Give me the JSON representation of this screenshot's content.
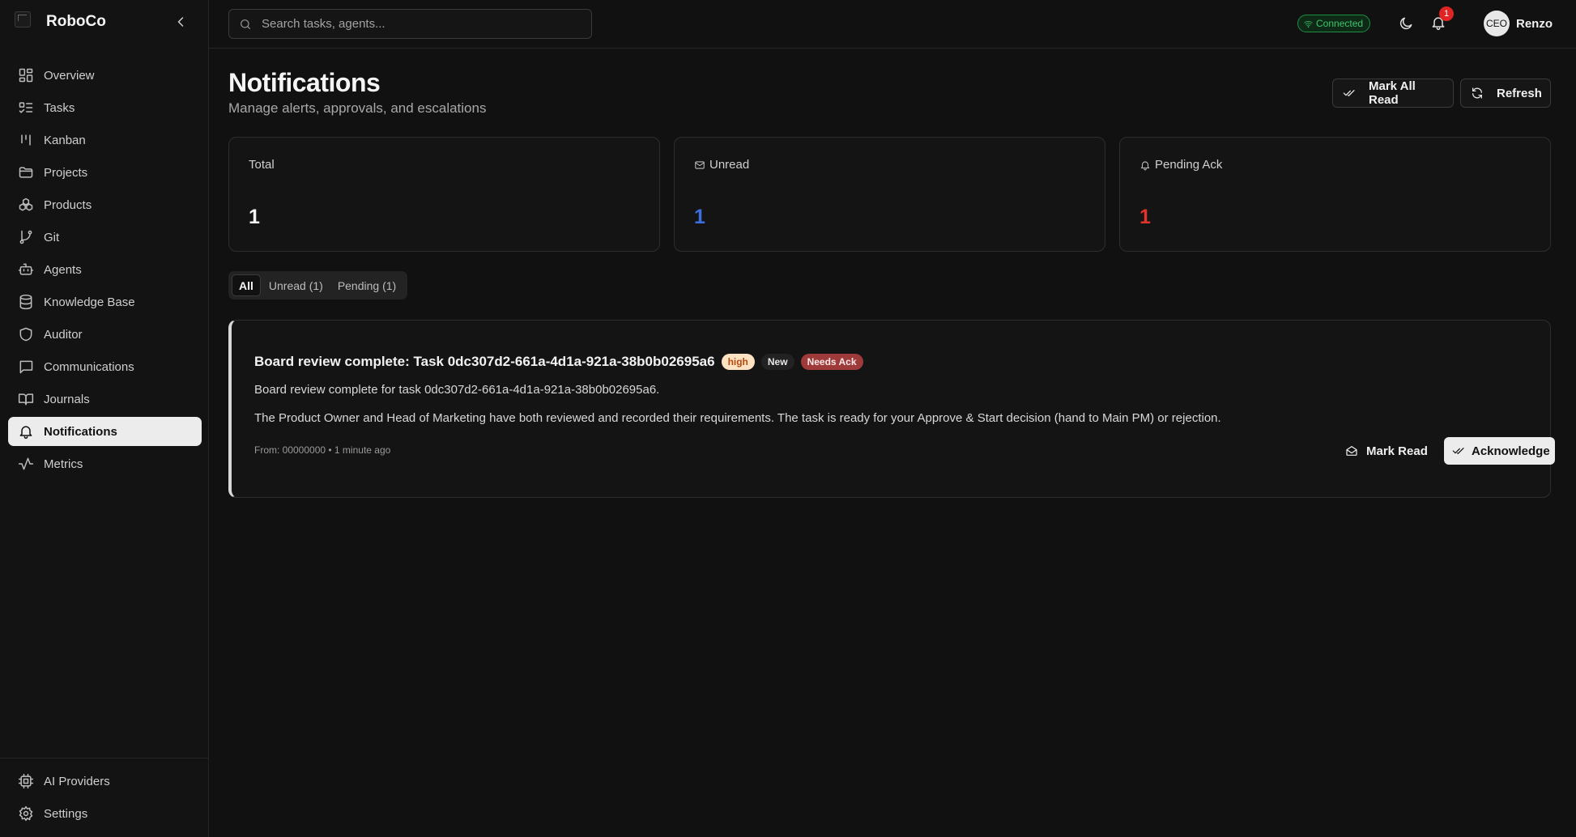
{
  "app": {
    "name": "RoboCo"
  },
  "sidebar": {
    "items": [
      {
        "label": "Overview",
        "icon": "layout-dashboard-icon"
      },
      {
        "label": "Tasks",
        "icon": "list-todo-icon"
      },
      {
        "label": "Kanban",
        "icon": "kanban-icon"
      },
      {
        "label": "Projects",
        "icon": "folder-icon"
      },
      {
        "label": "Products",
        "icon": "boxes-icon"
      },
      {
        "label": "Git",
        "icon": "git-branch-icon"
      },
      {
        "label": "Agents",
        "icon": "bot-icon"
      },
      {
        "label": "Knowledge Base",
        "icon": "database-icon"
      },
      {
        "label": "Auditor",
        "icon": "shield-icon"
      },
      {
        "label": "Communications",
        "icon": "message-square-icon"
      },
      {
        "label": "Journals",
        "icon": "book-open-icon"
      },
      {
        "label": "Notifications",
        "icon": "bell-icon",
        "active": true
      },
      {
        "label": "Metrics",
        "icon": "activity-icon"
      }
    ],
    "bottom_items": [
      {
        "label": "AI Providers",
        "icon": "cpu-icon"
      },
      {
        "label": "Settings",
        "icon": "gear-icon"
      }
    ]
  },
  "topbar": {
    "search_placeholder": "Search tasks, agents...",
    "status": "Connected",
    "notification_count": "1",
    "user_avatar": "CEO",
    "user_name": "Renzo"
  },
  "page": {
    "title": "Notifications",
    "subtitle": "Manage alerts, approvals, and escalations",
    "mark_all_read_label": "Mark All Read",
    "refresh_label": "Refresh"
  },
  "stats": [
    {
      "label": "Total",
      "value": "1",
      "color": "#f5f5f5"
    },
    {
      "label": "Unread",
      "value": "1",
      "color": "#3b6fe0"
    },
    {
      "label": "Pending Ack",
      "value": "1",
      "color": "#e0342a"
    }
  ],
  "tabs": [
    {
      "label": "All",
      "active": true
    },
    {
      "label": "Unread (1)"
    },
    {
      "label": "Pending (1)"
    }
  ],
  "notification": {
    "title": "Board review complete: Task 0dc307d2-661a-4d1a-921a-38b0b02695a6",
    "priority": "high",
    "status": "New",
    "ack_badge": "Needs Ack",
    "line1": "Board review complete for task 0dc307d2-661a-4d1a-921a-38b0b02695a6.",
    "line2": "The Product Owner and Head of Marketing have both reviewed and recorded their requirements. The task is ready for your Approve & Start decision (hand to Main PM) or rejection.",
    "meta": "From: 00000000 • 1 minute ago",
    "mark_read_label": "Mark Read",
    "acknowledge_label": "Acknowledge"
  }
}
